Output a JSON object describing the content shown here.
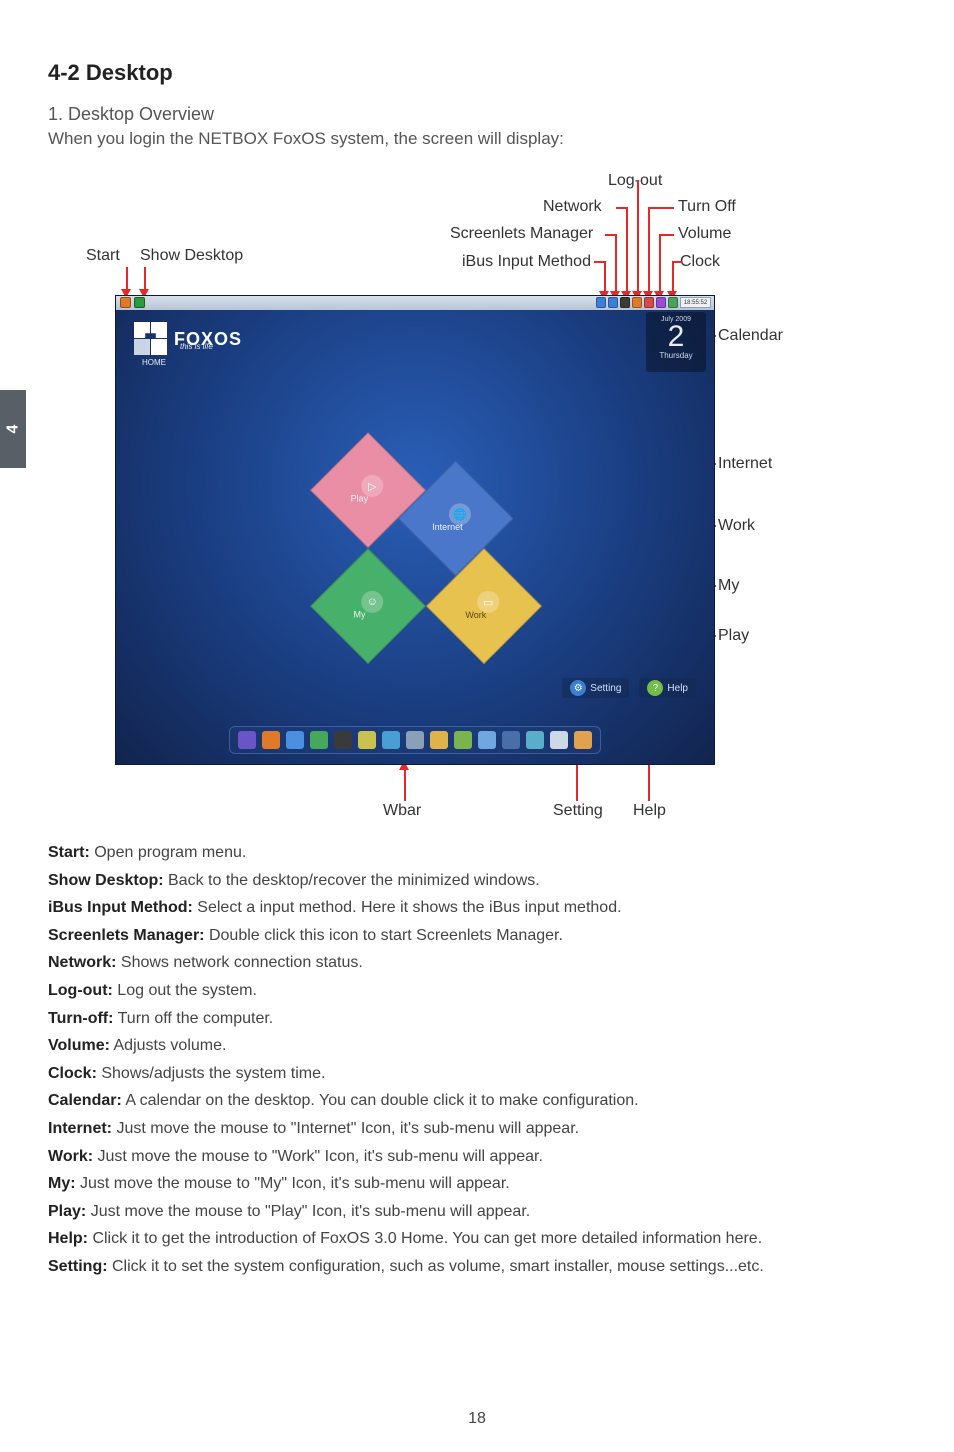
{
  "page": {
    "section_number_title": "4-2 Desktop",
    "sub_heading": "1. Desktop Overview",
    "intro": "When you login the NETBOX FoxOS system, the screen will display:",
    "page_number": "18",
    "side_tab": "4"
  },
  "top_labels": {
    "start": "Start",
    "show_desktop": "Show Desktop",
    "network": "Network",
    "logout": "Log-out",
    "turn_off": "Turn Off",
    "screenlets": "Screenlets Manager",
    "volume": "Volume",
    "ibus": "iBus Input Method",
    "clock": "Clock"
  },
  "right_labels": {
    "calendar": "Calendar",
    "internet": "Internet",
    "work": "Work",
    "my": "My",
    "play": "Play"
  },
  "bottom_labels": {
    "wbar": "Wbar",
    "setting": "Setting",
    "help": "Help"
  },
  "screenshot": {
    "logo_brand": "FOXOS",
    "logo_tagline": "this is life",
    "logo_home": "HOME",
    "clock_time": "18:55:52",
    "calendar": {
      "month": "July 2009",
      "day": "2",
      "weekday": "Thursday"
    },
    "pieces": {
      "internet": "Internet",
      "play": "Play",
      "work": "Work",
      "my": "My"
    },
    "setting_btn": "Setting",
    "help_btn": "Help",
    "tray_colors": [
      "#3b7fd6",
      "#3b7fd6",
      "#3a3a3a",
      "#e07a2a",
      "#d64a4a",
      "#9a4ad6",
      "#4aa35a"
    ],
    "dock_colors": [
      "#6a55c8",
      "#e07a2a",
      "#4a8fe0",
      "#45a85a",
      "#3a3a3a",
      "#c9c24f",
      "#4a9ed6",
      "#8aa0b8",
      "#e0b24a",
      "#7bb44f",
      "#6fa8e0",
      "#4a6fa8",
      "#5aaec9",
      "#cfd8e6",
      "#e0a24f"
    ]
  },
  "definitions": [
    {
      "term": "Start:",
      "desc": " Open program menu."
    },
    {
      "term": "Show Desktop:",
      "desc": " Back to the desktop/recover the minimized windows."
    },
    {
      "term": "iBus Input Method:",
      "desc": " Select a input method. Here it shows the iBus input method."
    },
    {
      "term": "Screenlets Manager:",
      "desc": " Double click this icon to start Screenlets Manager."
    },
    {
      "term": "Network:",
      "desc": " Shows network connection status."
    },
    {
      "term": "Log-out:",
      "desc": " Log out the system."
    },
    {
      "term": "Turn-off:",
      "desc": " Turn off the computer."
    },
    {
      "term": "Volume:",
      "desc": " Adjusts volume."
    },
    {
      "term": "Clock:",
      "desc": " Shows/adjusts the system time."
    },
    {
      "term": "Calendar:",
      "desc": " A calendar on the desktop. You can double click it to make configuration."
    },
    {
      "term": "Internet:",
      "desc": " Just move the mouse to \"Internet\" Icon, it's sub-menu will appear."
    },
    {
      "term": "Work:",
      "desc": " Just move the mouse to \"Work\" Icon, it's sub-menu will appear."
    },
    {
      "term": "My:",
      "desc": " Just move the mouse to \"My\" Icon, it's sub-menu will appear."
    },
    {
      "term": "Play:",
      "desc": " Just move the mouse to \"Play\" Icon, it's sub-menu will appear."
    },
    {
      "term": "Help:",
      "desc": " Click it to get the introduction of FoxOS 3.0 Home. You can get more detailed information here."
    },
    {
      "term": "Setting:",
      "desc": " Click it to set the system configuration, such as volume, smart installer, mouse settings...etc."
    }
  ]
}
